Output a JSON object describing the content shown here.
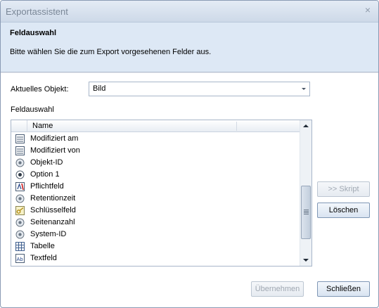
{
  "window": {
    "title": "Exportassistent",
    "close_glyph": "×"
  },
  "header": {
    "title": "Feldauswahl",
    "description": "Bitte wählen Sie die zum Export vorgesehenen Felder aus."
  },
  "object": {
    "label": "Aktuelles Objekt:",
    "value": "Bild"
  },
  "fields": {
    "label": "Feldauswahl",
    "column_name": "Name",
    "items": [
      {
        "label": "Modifiziert am",
        "icon": "date-field-icon"
      },
      {
        "label": "Modifiziert von",
        "icon": "date-field-icon"
      },
      {
        "label": "Objekt-ID",
        "icon": "system-field-icon"
      },
      {
        "label": "Option 1",
        "icon": "option-field-icon"
      },
      {
        "label": "Pflichtfeld",
        "icon": "required-field-icon"
      },
      {
        "label": "Retentionzeit",
        "icon": "system-field-icon"
      },
      {
        "label": "Schlüsselfeld",
        "icon": "key-field-icon"
      },
      {
        "label": "Seitenanzahl",
        "icon": "system-field-icon"
      },
      {
        "label": "System-ID",
        "icon": "system-field-icon"
      },
      {
        "label": "Tabelle",
        "icon": "table-field-icon"
      },
      {
        "label": "Textfeld",
        "icon": "text-field-icon"
      }
    ],
    "scroll_position": 0.72
  },
  "buttons": {
    "script": ">> Skript",
    "delete": "Löschen",
    "apply": "Übernehmen",
    "close": "Schließen"
  },
  "colors": {
    "header_bg": "#dde8f5",
    "button_border": "#7f97b5",
    "disabled_text": "#a0a8b2"
  }
}
